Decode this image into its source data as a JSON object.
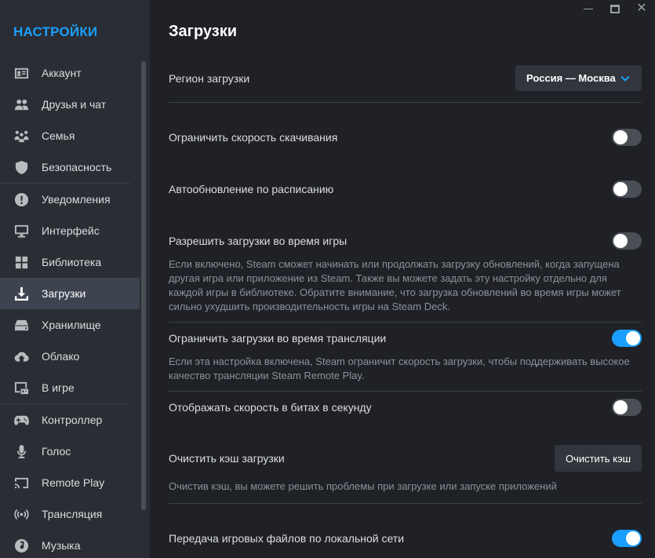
{
  "window": {
    "minimize_icon": "minimize-icon",
    "maximize_icon": "maximize-icon",
    "close_glyph": "✕"
  },
  "sidebar": {
    "title": "НАСТРОЙКИ",
    "items": [
      {
        "label": "Аккаунт",
        "icon": "id-card-icon"
      },
      {
        "label": "Друзья и чат",
        "icon": "friends-icon"
      },
      {
        "label": "Семья",
        "icon": "family-icon"
      },
      {
        "label": "Безопасность",
        "icon": "shield-icon"
      },
      {
        "label": "Уведомления",
        "icon": "alert-icon"
      },
      {
        "label": "Интерфейс",
        "icon": "monitor-icon"
      },
      {
        "label": "Библиотека",
        "icon": "grid-icon"
      },
      {
        "label": "Загрузки",
        "icon": "download-icon"
      },
      {
        "label": "Хранилище",
        "icon": "storage-icon"
      },
      {
        "label": "Облако",
        "icon": "cloud-icon"
      },
      {
        "label": "В игре",
        "icon": "ingame-icon"
      },
      {
        "label": "Контроллер",
        "icon": "gamepad-icon"
      },
      {
        "label": "Голос",
        "icon": "microphone-icon"
      },
      {
        "label": "Remote Play",
        "icon": "cast-icon"
      },
      {
        "label": "Трансляция",
        "icon": "broadcast-icon"
      },
      {
        "label": "Музыка",
        "icon": "music-icon"
      }
    ],
    "active_item": "Загрузки"
  },
  "main": {
    "title": "Загрузки",
    "region": {
      "label": "Регион загрузки",
      "value": "Россия — Москва"
    },
    "limit_speed": {
      "label": "Ограничить скорость скачивания",
      "on": false
    },
    "schedule": {
      "label": "Автообновление по расписанию",
      "on": false
    },
    "allow_ingame": {
      "label": "Разрешить загрузки во время игры",
      "on": false,
      "desc": "Если включено, Steam сможет начинать или продолжать загрузку обновлений, когда запущена другая игра или приложение из Steam. Также вы можете задать эту настройку отдельно для каждой игры в библиотеке. Обратите внимание, что загрузка обновлений во время игры может сильно ухудшить производительность игры на Steam Deck."
    },
    "limit_broadcast": {
      "label": "Ограничить загрузки во время трансляции",
      "on": true,
      "desc": "Если эта настройка включена, Steam ограничит скорость загрузки, чтобы поддерживать высокое качество трансляции Steam Remote Play."
    },
    "bits": {
      "label": "Отображать скорость в битах в секунду",
      "on": false
    },
    "cache": {
      "label": "Очистить кэш загрузки",
      "button": "Очистить кэш",
      "desc": "Очистив кэш, вы можете решить проблемы при загрузке или запуске приложений"
    },
    "lan": {
      "label": "Передача игровых файлов по локальной сети",
      "on": true
    }
  },
  "colors": {
    "accent": "#1a9fff",
    "sidebar_bg": "#2a2d33",
    "main_bg": "#1f2126",
    "active_item_bg": "#3d4450"
  }
}
